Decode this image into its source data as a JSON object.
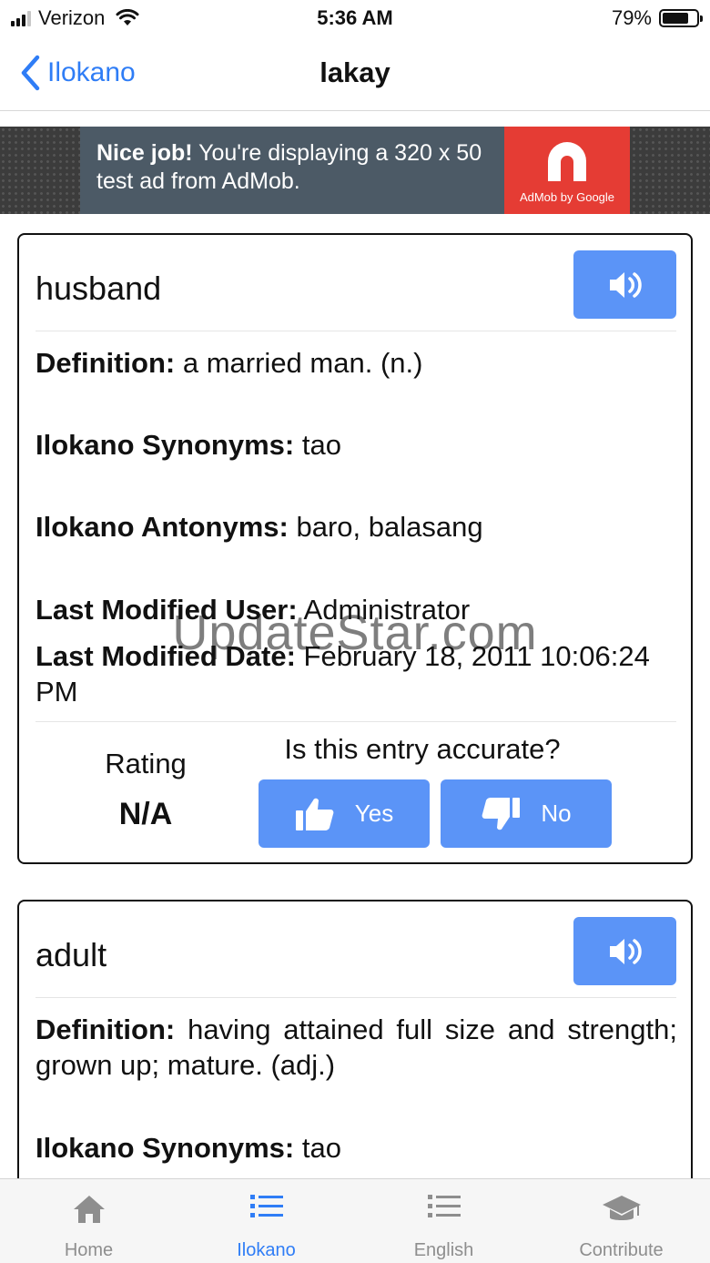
{
  "status_bar": {
    "carrier": "Verizon",
    "time": "5:36 AM",
    "battery": "79%",
    "battery_level": 0.79
  },
  "nav": {
    "back_label": "Ilokano",
    "title": "lakay"
  },
  "ad": {
    "headline": "Nice job!",
    "body": " You're displaying a 320 x 50 test ad from AdMob.",
    "brand": "AdMob by Google"
  },
  "entries": [
    {
      "word": "husband",
      "definition_label": "Definition:",
      "definition": " a married man. (n.)",
      "synonyms_label": "Ilokano Synonyms:",
      "synonyms": " tao",
      "antonyms_label": "Ilokano Antonyms:",
      "antonyms": " baro, balasang",
      "modified_user_label": "Last Modified User:",
      "modified_user": " Administrator",
      "modified_date_label": "Last Modified Date:",
      "modified_date": " February 18, 2011 10:06:24 PM",
      "rating_label": "Rating",
      "rating_value": "N/A",
      "accuracy_question": "Is this entry accurate?",
      "yes_label": "Yes",
      "no_label": "No"
    },
    {
      "word": "adult",
      "definition_label": "Definition:",
      "definition": " having attained full size and strength; grown up; mature. (adj.)",
      "synonyms_label": "Ilokano Synonyms:",
      "synonyms": " tao"
    }
  ],
  "watermark": "UpdateStar.com",
  "tabs": [
    {
      "label": "Home",
      "icon": "home-icon",
      "active": false
    },
    {
      "label": "Ilokano",
      "icon": "list-icon",
      "active": true
    },
    {
      "label": "English",
      "icon": "list-icon",
      "active": false
    },
    {
      "label": "Contribute",
      "icon": "graduation-cap-icon",
      "active": false
    }
  ],
  "colors": {
    "accent": "#2f7df6",
    "button": "#5b94f7",
    "inactive_tab": "#8e8e8e",
    "ad_red": "#e53c34"
  }
}
